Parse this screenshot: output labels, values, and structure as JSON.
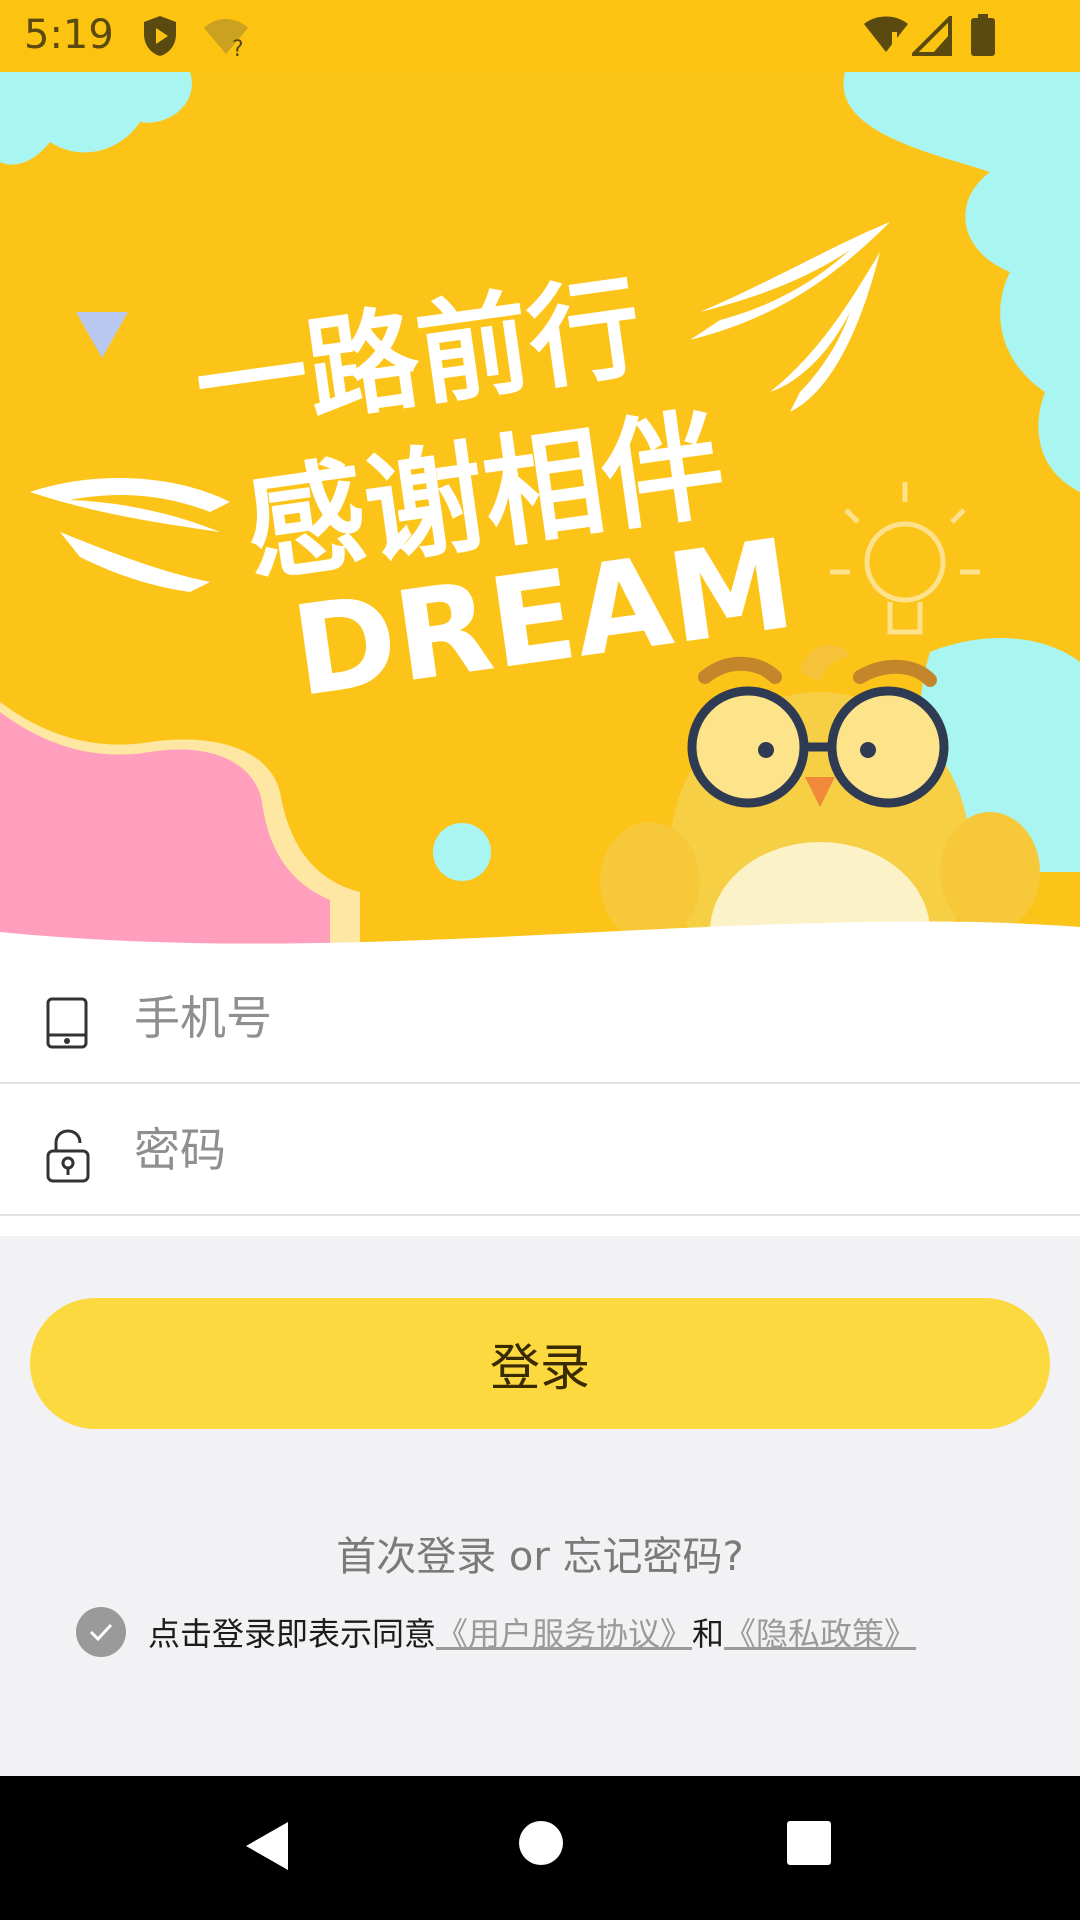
{
  "status_bar": {
    "time": "5:19"
  },
  "banner": {
    "line1": "一路前行",
    "line2": "感谢相伴",
    "line3": "DREAM"
  },
  "form": {
    "phone_placeholder": "手机号",
    "password_placeholder": "密码"
  },
  "login_button": {
    "label": "登录"
  },
  "first_login": {
    "text": "首次登录 or 忘记密码?"
  },
  "agreement": {
    "prefix": "点击登录即表示同意",
    "user_agreement": "《用户服务协议》",
    "and": "和",
    "privacy_policy": "《隐私政策》"
  },
  "colors": {
    "accent": "#fcc410",
    "button": "#fbd93f"
  }
}
